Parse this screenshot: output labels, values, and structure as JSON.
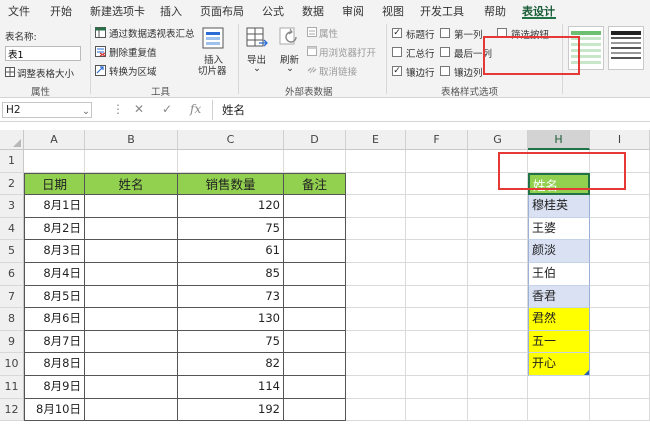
{
  "tabs": [
    "文件",
    "开始",
    "新建选项卡",
    "插入",
    "页面布局",
    "公式",
    "数据",
    "审阅",
    "视图",
    "开发工具",
    "帮助",
    "表设计"
  ],
  "active_tab": "表设计",
  "ribbon": {
    "properties": {
      "table_name_label": "表名称:",
      "table_name_value": "表1",
      "resize_label": "调整表格大小",
      "group_label": "属性"
    },
    "tools": {
      "summarize_pivot": "通过数据透视表汇总",
      "remove_duplicates": "删除重复值",
      "convert_to_range": "转换为区域",
      "insert_slicer_line1": "插入",
      "insert_slicer_line2": "切片器",
      "group_label": "工具"
    },
    "external": {
      "export_label": "导出",
      "refresh_label": "刷新",
      "properties_label": "属性",
      "open_browser_label": "用浏览器打开",
      "unlink_label": "取消链接",
      "group_label": "外部表数据"
    },
    "style_options": {
      "header_row": {
        "label": "标题行",
        "checked": true
      },
      "total_row": {
        "label": "汇总行",
        "checked": false
      },
      "banded_rows": {
        "label": "镶边行",
        "checked": true
      },
      "first_column": {
        "label": "第一列",
        "checked": false
      },
      "last_column": {
        "label": "最后一列",
        "checked": false
      },
      "banded_columns": {
        "label": "镶边列",
        "checked": false
      },
      "filter_button": {
        "label": "筛选按钮",
        "checked": false
      },
      "group_label": "表格样式选项"
    }
  },
  "formula_bar": {
    "name_box": "H2",
    "fx": "fx",
    "cancel": "✕",
    "confirm": "✓",
    "content": "姓名"
  },
  "columns": [
    "A",
    "B",
    "C",
    "D",
    "E",
    "F",
    "G",
    "H",
    "I"
  ],
  "selected_column": "H",
  "rows": [
    "1",
    "2",
    "3",
    "4",
    "5",
    "6",
    "7",
    "8",
    "9",
    "10",
    "11",
    "12"
  ],
  "table": {
    "headers": [
      "日期",
      "姓名",
      "销售数量",
      "备注"
    ],
    "dates": [
      "8月1日",
      "8月2日",
      "8月3日",
      "8月4日",
      "8月5日",
      "8月6日",
      "8月7日",
      "8月8日",
      "8月9日",
      "8月10日"
    ],
    "quantities": [
      120,
      75,
      61,
      85,
      73,
      130,
      75,
      82,
      114,
      192
    ]
  },
  "name_table": {
    "header": "姓名",
    "names": [
      "穆桂英",
      "王婆",
      "颜淡",
      "王伯",
      "香君",
      "君然",
      "五一",
      "开心"
    ],
    "fills": [
      "#d9e1f2",
      "#ffffff",
      "#d9e1f2",
      "#ffffff",
      "#d9e1f2",
      "#ffff00",
      "#ffff00",
      "#ffff00"
    ]
  },
  "colors": {
    "accent": "#217346",
    "header_green": "#92d050",
    "highlight_red": "#e53935",
    "yellow": "#ffff00",
    "band_blue": "#d9e1f2"
  }
}
